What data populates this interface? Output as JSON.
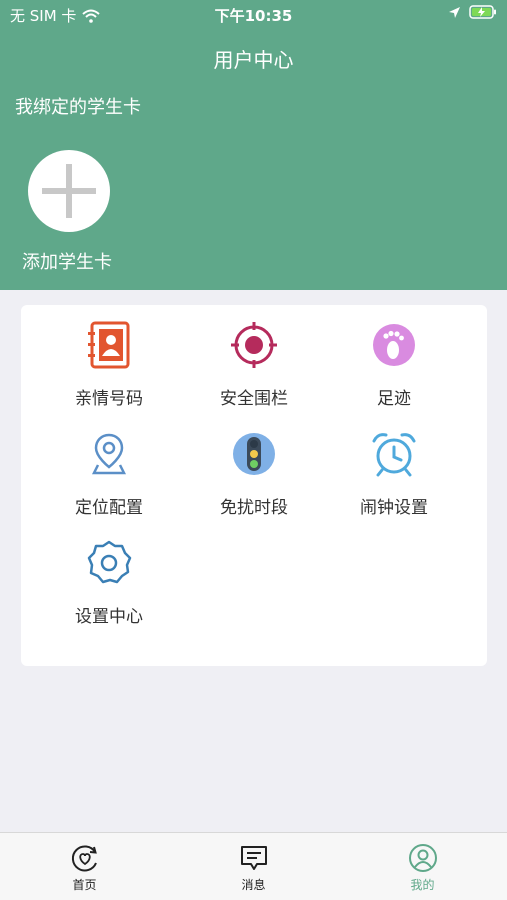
{
  "status": {
    "carrier": "无 SIM 卡",
    "time": "下午10:35"
  },
  "nav": {
    "title": "用户中心"
  },
  "cards": {
    "section_title": "我绑定的学生卡",
    "add_label": "添加学生卡"
  },
  "menu": [
    {
      "label": "亲情号码",
      "icon": "contacts-book-icon"
    },
    {
      "label": "安全围栏",
      "icon": "target-fence-icon"
    },
    {
      "label": "足迹",
      "icon": "footprint-icon"
    },
    {
      "label": "定位配置",
      "icon": "location-pin-icon"
    },
    {
      "label": "免扰时段",
      "icon": "traffic-light-icon"
    },
    {
      "label": "闹钟设置",
      "icon": "alarm-clock-icon"
    },
    {
      "label": "设置中心",
      "icon": "gear-icon"
    }
  ],
  "tabs": [
    {
      "label": "首页",
      "icon": "home-heart-icon"
    },
    {
      "label": "消息",
      "icon": "message-icon"
    },
    {
      "label": "我的",
      "icon": "user-icon"
    }
  ],
  "colors": {
    "primary": "#5fa88a",
    "contacts": "#e2552f",
    "fence": "#b52b5c",
    "footprint": "#d98be0",
    "location": "#5b8fc7",
    "traffic": "#7fb0e6",
    "alarm": "#4fa9dc",
    "gear": "#3a7fb5"
  }
}
